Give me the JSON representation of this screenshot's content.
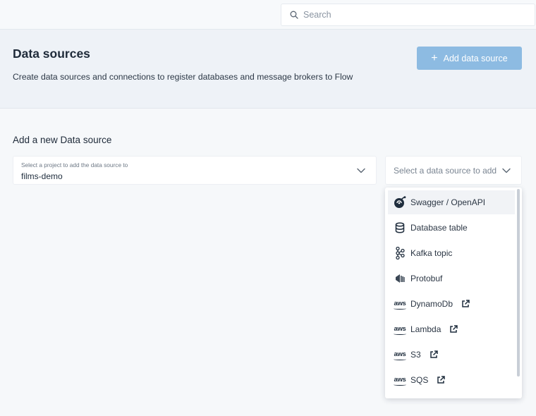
{
  "search": {
    "placeholder": "Search"
  },
  "header": {
    "title": "Data sources",
    "subtitle": "Create data sources and connections to register databases and message brokers to Flow",
    "add_button": {
      "icon": "plus-icon",
      "label": "Add data source"
    }
  },
  "form": {
    "section_title": "Add a new Data source",
    "project_select": {
      "hint": "Select a project to add the data source to",
      "value": "films-demo"
    },
    "datasource_select": {
      "placeholder": "Select a data source to add"
    }
  },
  "dropdown": {
    "items": [
      {
        "label": "Swagger / OpenAPI",
        "icon": "swagger-icon",
        "external": false
      },
      {
        "label": "Database table",
        "icon": "database-icon",
        "external": false
      },
      {
        "label": "Kafka topic",
        "icon": "kafka-icon",
        "external": false
      },
      {
        "label": "Protobuf",
        "icon": "protobuf-icon",
        "external": false
      },
      {
        "label": "DynamoDb",
        "icon": "aws-icon",
        "external": true
      },
      {
        "label": "Lambda",
        "icon": "aws-icon",
        "external": true
      },
      {
        "label": "S3",
        "icon": "aws-icon",
        "external": true
      },
      {
        "label": "SQS",
        "icon": "aws-icon",
        "external": true
      }
    ]
  },
  "colors": {
    "accent": "#8dbbe2",
    "header_bg": "#eef2f7",
    "page_bg": "#f6f8fa"
  }
}
